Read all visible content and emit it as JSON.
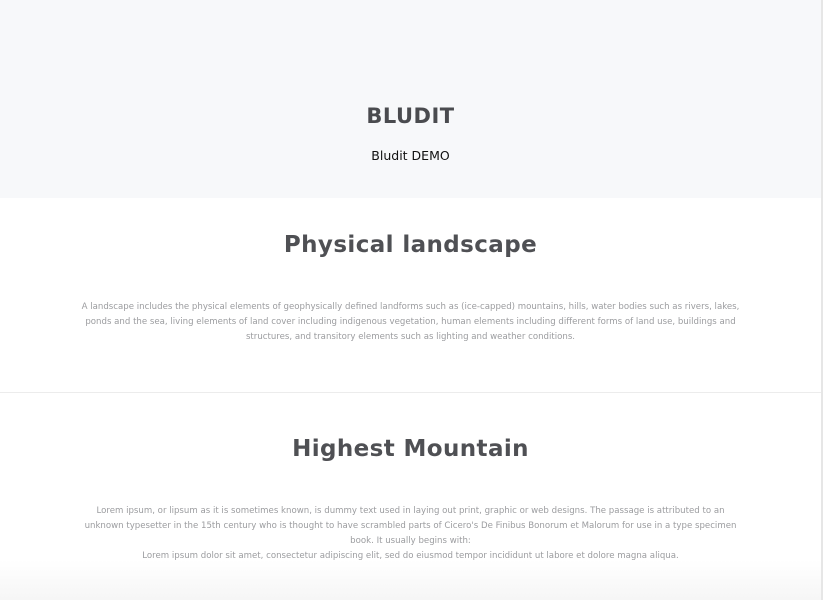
{
  "header": {
    "site_title": "BLUDIT",
    "slogan": "Bludit DEMO"
  },
  "posts": [
    {
      "title": "Physical landscape",
      "paragraphs": [
        "A landscape includes the physical elements of geophysically defined landforms such as (ice-capped) mountains, hills, water bodies such as rivers, lakes, ponds and the sea, living elements of land cover including indigenous vegetation, human elements including different forms of land use, buildings and structures, and transitory elements such as lighting and weather conditions."
      ]
    },
    {
      "title": "Highest Mountain",
      "paragraphs": [
        "Lorem ipsum, or lipsum as it is sometimes known, is dummy text used in laying out print, graphic or web designs. The passage is attributed to an unknown typesetter in the 15th century who is thought to have scrambled parts of Cicero's De Finibus Bonorum et Malorum for use in a type specimen book. It usually begins with:",
        "Lorem ipsum dolor sit amet, consectetur adipiscing elit, sed do eiusmod tempor incididunt ut labore et dolore magna aliqua."
      ]
    }
  ]
}
